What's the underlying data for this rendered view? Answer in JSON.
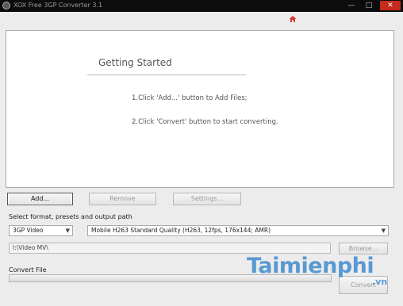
{
  "window": {
    "title": "XOX Free 3GP Converter 3.1",
    "min_glyph": "—",
    "max_glyph": "□",
    "close_glyph": "✕"
  },
  "getting_started": {
    "title": "Getting Started",
    "step1": "1.Click 'Add...' button to Add Files;",
    "step2": "2.Click 'Convert' button to start converting."
  },
  "buttons": {
    "add": "Add...",
    "remove": "Remove",
    "settings": "Settings...",
    "browse": "Browse...",
    "convert": "Convert"
  },
  "format_section": {
    "label": "Select format, presets and output path",
    "format_value": "3GP Video",
    "quality_value": "Mobile H263 Standard Quality  (H263, 12fps, 176x144;  AMR)",
    "output_path": "I:\\Video MV\\"
  },
  "convert_section": {
    "label": "Convert File",
    "progress": 0
  },
  "watermark": {
    "text": "Taimienphi",
    "suffix": ".vn"
  },
  "colors": {
    "titlebar": "#0c0c0c",
    "close": "#c42b1c",
    "accent": "#1e78c8"
  }
}
